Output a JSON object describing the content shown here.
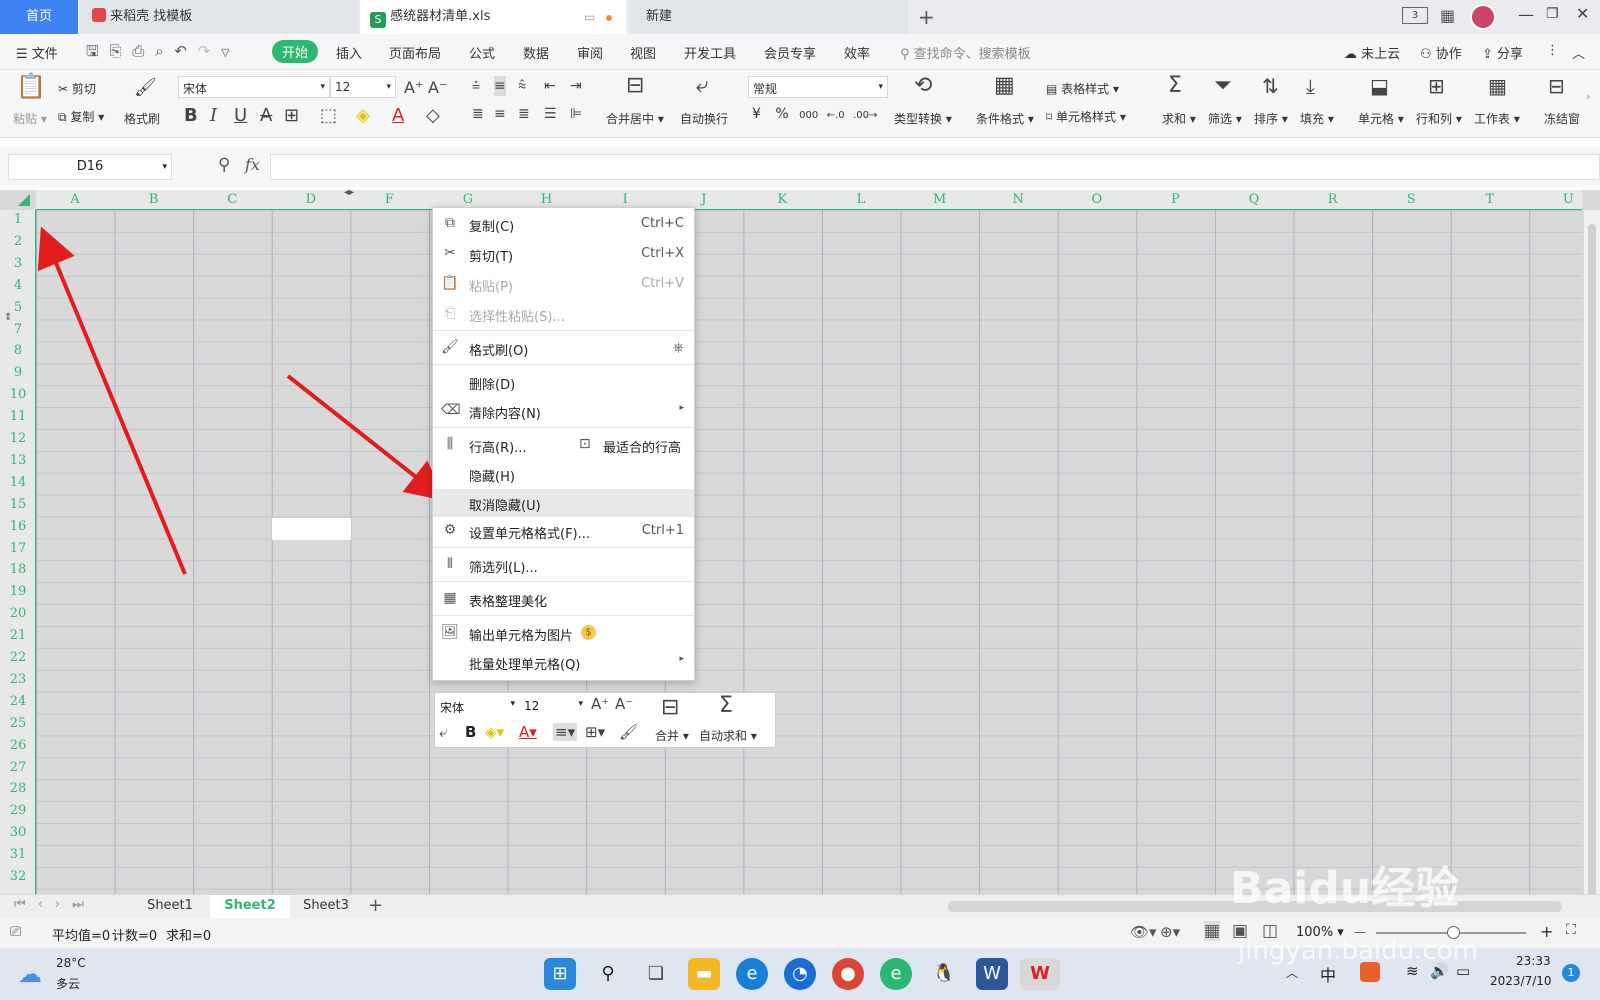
{
  "tabs": [
    {
      "label": "首页"
    },
    {
      "label": "来稻壳 找模板"
    },
    {
      "label": "感统器材清单.xls"
    },
    {
      "label": "新建"
    }
  ],
  "top_right": {
    "badge": "3"
  },
  "menu": {
    "file": "文件",
    "items": [
      "开始",
      "插入",
      "页面布局",
      "公式",
      "数据",
      "审阅",
      "视图",
      "开发工具",
      "会员专享",
      "效率"
    ],
    "search_placeholder": "查找命令、搜索模板",
    "cloud": "未上云",
    "collab": "协作",
    "share": "分享"
  },
  "ribbon": {
    "paste": "粘贴",
    "cut": "剪切",
    "copy": "复制",
    "format_painter": "格式刷",
    "font_name": "宋体",
    "font_size": "12",
    "merge": "合并居中",
    "wrap": "自动换行",
    "number_format": "常规",
    "type_convert": "类型转换",
    "cond_format": "条件格式",
    "table_style": "表格样式",
    "cell_style": "单元格样式",
    "sum": "求和",
    "filter": "筛选",
    "sort": "排序",
    "fill": "填充",
    "cell": "单元格",
    "rowcol": "行和列",
    "worksheet": "工作表",
    "freeze": "冻结窗"
  },
  "formula": {
    "name_box": "D16",
    "fx": "fx",
    "value": ""
  },
  "columns": [
    "A",
    "B",
    "C",
    "D",
    "F",
    "G",
    "H",
    "I",
    "J",
    "K",
    "L",
    "M",
    "N",
    "O",
    "P",
    "Q",
    "R",
    "S",
    "T",
    "U"
  ],
  "rows": [
    "1",
    "2",
    "3",
    "4",
    "5",
    "7",
    "8",
    "9",
    "10",
    "11",
    "12",
    "13",
    "14",
    "15",
    "16",
    "17",
    "18",
    "19",
    "20",
    "21",
    "22",
    "23",
    "24",
    "25",
    "26",
    "27",
    "28",
    "29",
    "30",
    "31",
    "32"
  ],
  "context_menu": [
    {
      "label": "复制(C)",
      "shortcut": "Ctrl+C",
      "icon": "copy-icon"
    },
    {
      "label": "剪切(T)",
      "shortcut": "Ctrl+X",
      "icon": "scissors-icon"
    },
    {
      "label": "粘贴(P)",
      "shortcut": "Ctrl+V",
      "icon": "paste-icon"
    },
    {
      "label": "选择性粘贴(S)...",
      "shortcut": "",
      "icon": "paste-special-icon"
    },
    {
      "label": "格式刷(O)",
      "shortcut": "",
      "icon": "format-painter-icon"
    },
    {
      "label": "删除(D)",
      "shortcut": "",
      "icon": ""
    },
    {
      "label": "清除内容(N)",
      "shortcut": "",
      "icon": "eraser-icon"
    },
    {
      "label": "行高(R)...",
      "shortcut": "",
      "icon": "row-height-icon",
      "extra": "最适合的行高"
    },
    {
      "label": "隐藏(H)",
      "shortcut": "",
      "icon": ""
    },
    {
      "label": "取消隐藏(U)",
      "shortcut": "",
      "icon": ""
    },
    {
      "label": "设置单元格格式(F)...",
      "shortcut": "Ctrl+1",
      "icon": "cell-format-icon"
    },
    {
      "label": "筛选列(L)...",
      "shortcut": "",
      "icon": "filter-column-icon"
    },
    {
      "label": "表格整理美化",
      "shortcut": "",
      "icon": "table-beautify-icon"
    },
    {
      "label": "输出单元格为图片",
      "shortcut": "",
      "icon": "export-image-icon"
    },
    {
      "label": "批量处理单元格(Q)",
      "shortcut": "",
      "icon": ""
    }
  ],
  "mini_toolbar": {
    "font_name": "宋体",
    "font_size": "12",
    "merge": "合并",
    "autosum": "自动求和"
  },
  "sheets": [
    "Sheet1",
    "Sheet2",
    "Sheet3"
  ],
  "status": {
    "avg": "平均值=0",
    "count": "计数=0",
    "sum": "求和=0",
    "zoom": "100%"
  },
  "taskbar": {
    "temp": "28°C",
    "weather": "多云",
    "ime": "中",
    "time": "23:33",
    "date": "2023/7/10",
    "notif": "1"
  },
  "watermark": {
    "line1": "Baidu经验",
    "line2": "jingyan.baidu.com"
  }
}
